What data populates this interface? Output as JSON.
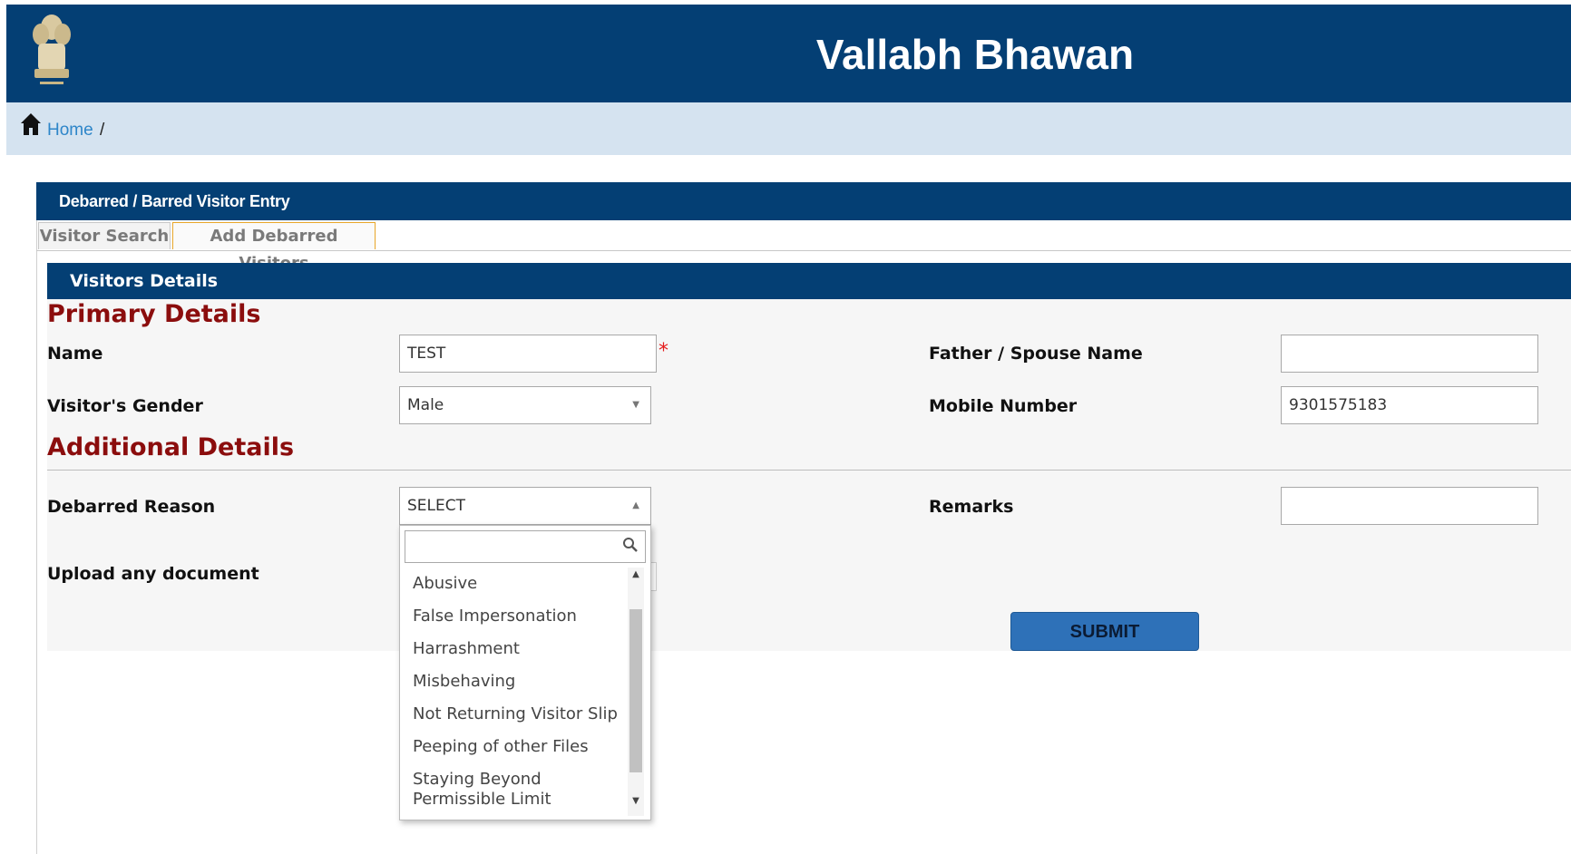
{
  "header": {
    "title": "Vallabh Bhawan"
  },
  "breadcrumb": {
    "home_label": "Home",
    "separator": "/"
  },
  "panel": {
    "title": "Debarred / Barred Visitor Entry"
  },
  "tabs": [
    {
      "label": "Visitor Search"
    },
    {
      "label": "Add Debarred Visitors"
    }
  ],
  "section": {
    "title": "Visitors Details"
  },
  "primary": {
    "heading": "Primary Details",
    "name_label": "Name",
    "name_value": "TEST",
    "required_mark": "*",
    "father_label": "Father / Spouse Name",
    "father_value": "",
    "gender_label": "Visitor's Gender",
    "gender_value": "Male",
    "mobile_label": "Mobile Number",
    "mobile_value": "9301575183"
  },
  "additional": {
    "heading": "Additional Details",
    "reason_label": "Debarred Reason",
    "reason_value": "SELECT",
    "remarks_label": "Remarks",
    "remarks_value": "",
    "upload_label": "Upload any document"
  },
  "dropdown": {
    "search_value": "",
    "options": [
      "Abusive",
      "False Impersonation",
      "Harrashment",
      "Misbehaving",
      "Not Returning Visitor Slip",
      "Peeping of other Files",
      "Staying Beyond Permissible Limit"
    ]
  },
  "submit_label": "SUBMIT",
  "colors": {
    "header_bg": "#043f74",
    "breadcrumb_bg": "#d5e3f0",
    "heading": "#8b0d0d",
    "submit_bg": "#2e71b8"
  }
}
